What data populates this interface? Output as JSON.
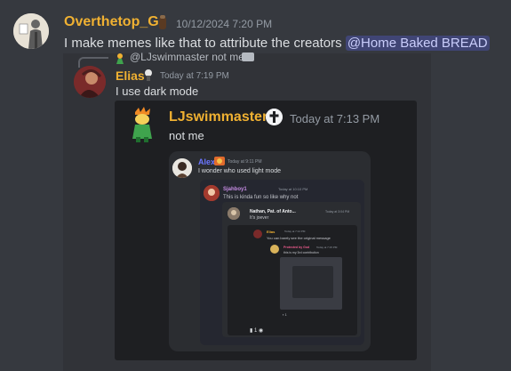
{
  "messages": {
    "top": {
      "author": "Overthetop_G",
      "timestamp": "10/12/2024 7:20 PM",
      "text_before": "I make memes like that to attribute the creators ",
      "mention": "@Home Baked BREAD"
    },
    "reply": {
      "mention": "@LJswimmaster",
      "text": "not me"
    },
    "elias": {
      "author": "Elias",
      "timestamp": "Today at 7:19 PM",
      "text": "I use dark mode"
    },
    "lj": {
      "author": "LJswimmaster",
      "timestamp": "Today at 7:13 PM",
      "text": "not me"
    },
    "alex": {
      "author": "Alex",
      "timestamp": "Today at 9:11 PM",
      "text": "I wonder who used light mode"
    },
    "sjah": {
      "author": "Sjahboy1",
      "timestamp": "Today at 10:10 PM",
      "text": "This is kinda fun so like why not"
    },
    "nathan": {
      "author": "Nathan, Pat. of Anto...",
      "timestamp": "Today at 3:04 PM",
      "text": "It's joever"
    },
    "elias2": {
      "author": "Elias",
      "timestamp": "Today at 7:14 PM",
      "text": "You can barely see the original message"
    },
    "prot": {
      "author": "Protected by God",
      "timestamp": "Today at 7:15 PM",
      "text": "this is my 3rd contribution"
    },
    "reactions_small": "1",
    "reactions": "1"
  },
  "colors": {
    "name_gold": "#f0b132",
    "mention_bg": "#5865f2",
    "background": "#36393f"
  }
}
